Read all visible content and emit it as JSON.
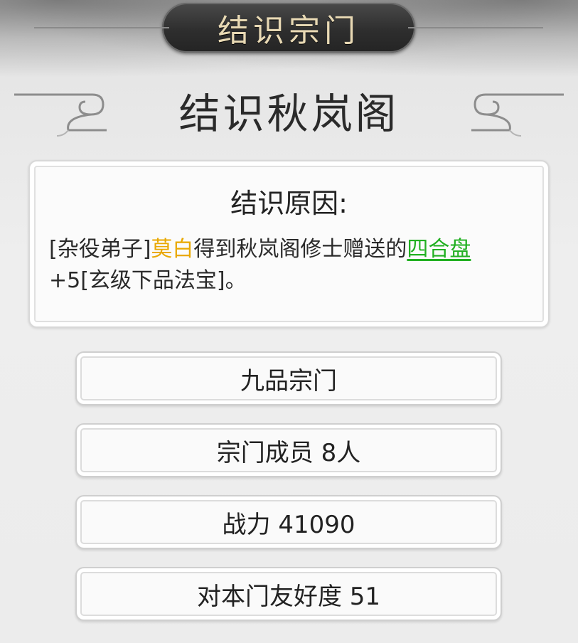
{
  "header": {
    "title": "结识宗门"
  },
  "sect": {
    "subtitle": "结识秋岚阁"
  },
  "reason": {
    "title": "结识原因:",
    "prefix": "[杂役弟子]",
    "disciple_name": "莫白",
    "middle": "得到秋岚阁修士赠送的",
    "item_name": "四合盘",
    "suffix": "+5[玄级下品法宝]。"
  },
  "stats": [
    {
      "label": "九品宗门"
    },
    {
      "label": "宗门成员 8人"
    },
    {
      "label": "战力 41090"
    },
    {
      "label": "对本门友好度 51"
    }
  ],
  "colors": {
    "disciple_name": "#e9a800",
    "item_name": "#22b022",
    "title_text": "#e8d9b4"
  },
  "icons": {
    "left_ornament": "cloud-scroll-left-icon",
    "right_ornament": "cloud-scroll-right-icon"
  }
}
